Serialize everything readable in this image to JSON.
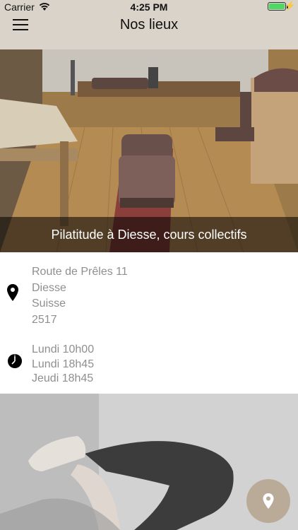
{
  "status_bar": {
    "carrier": "Carrier",
    "time": "4:25 PM",
    "battery_level": 1.0
  },
  "header": {
    "title": "Nos lieux",
    "menu_icon": "hamburger-menu-icon"
  },
  "location": {
    "caption": "Pilatitude à Diesse, cours collectifs",
    "address": {
      "street": "Route de Prêles 11",
      "city": "Diesse",
      "country": "Suisse",
      "postal_code": "2517"
    },
    "schedule": [
      "Lundi 10h00",
      "Lundi 18h45",
      "Jeudi 18h45"
    ]
  },
  "fab": {
    "icon": "map-pin-icon"
  },
  "colors": {
    "header_bg": "#d9d3c9",
    "fab_bg": "#b9ab98",
    "secondary_text": "#8f8f8f"
  }
}
